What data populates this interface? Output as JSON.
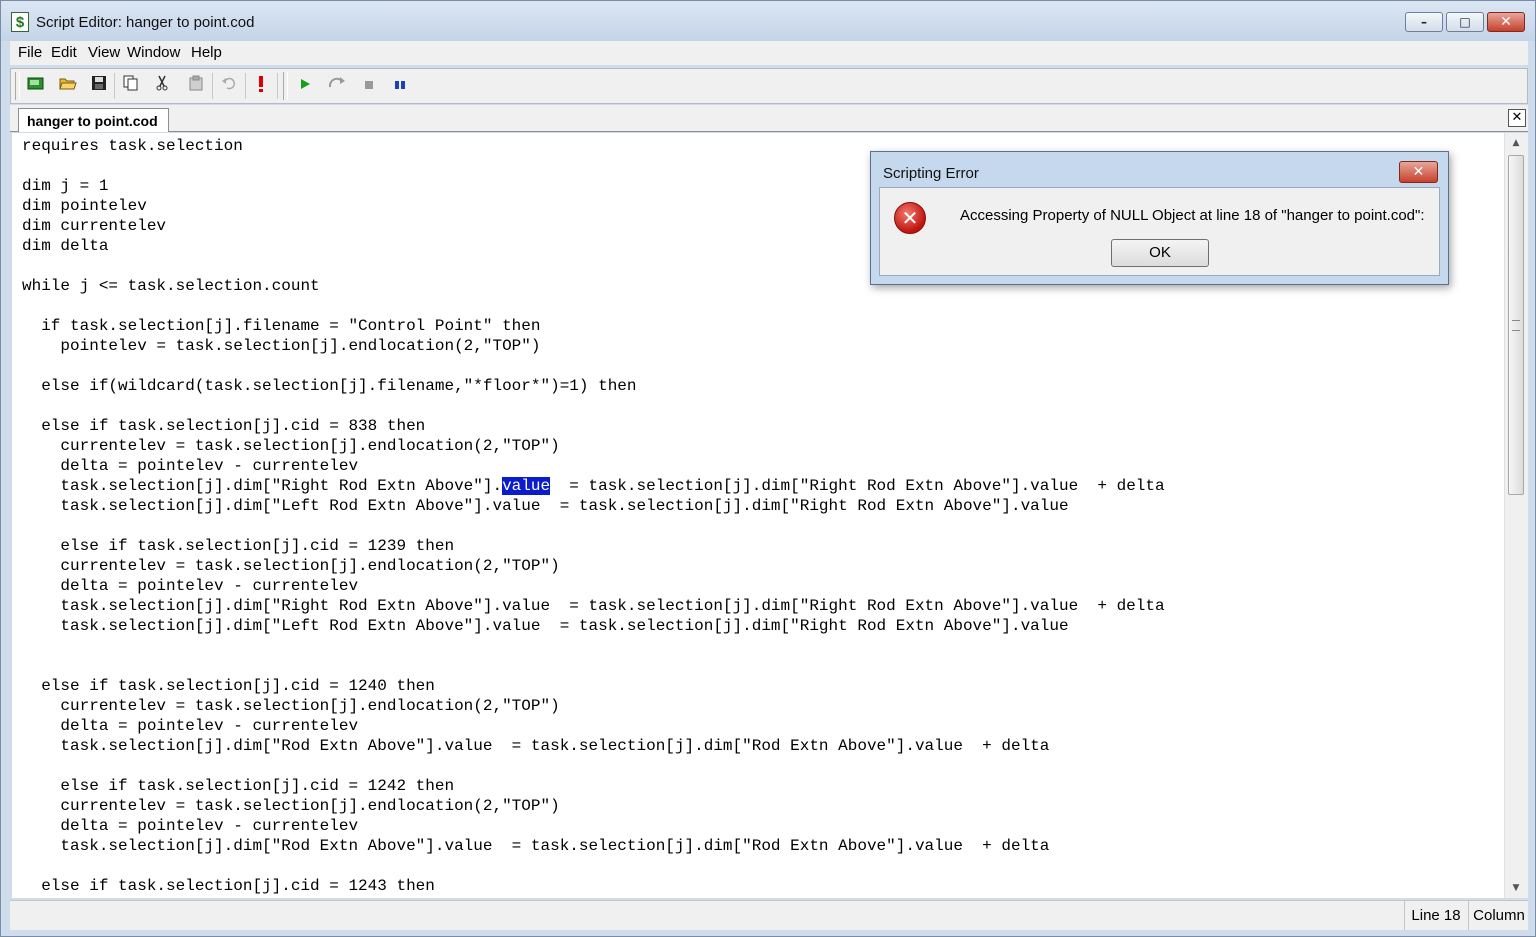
{
  "window": {
    "title": "Script Editor: hanger to point.cod",
    "controls": {
      "minimize": "–",
      "maximize": "□",
      "close": "✕"
    }
  },
  "menu": [
    "File",
    "Edit",
    "View",
    "Window",
    "Help"
  ],
  "toolbar": {
    "icons": [
      "new-script-icon",
      "open-folder-icon",
      "save-icon",
      "copy-icon",
      "cut-icon",
      "paste-icon",
      "undo-icon",
      "error-mark-icon",
      "run-icon",
      "step-icon",
      "stop-icon",
      "pause-icon"
    ]
  },
  "tab": {
    "label": "hanger to point.cod",
    "close": "✕"
  },
  "code": {
    "before": "requires task.selection\n\ndim j = 1\ndim pointelev\ndim currentelev\ndim delta\n\nwhile j <= task.selection.count\n\n  if task.selection[j].filename = \"Control Point\" then\n    pointelev = task.selection[j].endlocation(2,\"TOP\")\n\n  else if(wildcard(task.selection[j].filename,\"*floor*\")=1) then\n\n  else if task.selection[j].cid = 838 then\n    currentelev = task.selection[j].endlocation(2,\"TOP\")\n    delta = pointelev - currentelev\n    task.selection[j].dim[\"Right Rod Extn Above\"].",
    "selected": "value",
    "after": "  = task.selection[j].dim[\"Right Rod Extn Above\"].value  + delta\n    task.selection[j].dim[\"Left Rod Extn Above\"].value  = task.selection[j].dim[\"Right Rod Extn Above\"].value\n\n    else if task.selection[j].cid = 1239 then\n    currentelev = task.selection[j].endlocation(2,\"TOP\")\n    delta = pointelev - currentelev\n    task.selection[j].dim[\"Right Rod Extn Above\"].value  = task.selection[j].dim[\"Right Rod Extn Above\"].value  + delta\n    task.selection[j].dim[\"Left Rod Extn Above\"].value  = task.selection[j].dim[\"Right Rod Extn Above\"].value\n\n\n  else if task.selection[j].cid = 1240 then\n    currentelev = task.selection[j].endlocation(2,\"TOP\")\n    delta = pointelev - currentelev\n    task.selection[j].dim[\"Rod Extn Above\"].value  = task.selection[j].dim[\"Rod Extn Above\"].value  + delta\n\n    else if task.selection[j].cid = 1242 then\n    currentelev = task.selection[j].endlocation(2,\"TOP\")\n    delta = pointelev - currentelev\n    task.selection[j].dim[\"Rod Extn Above\"].value  = task.selection[j].dim[\"Rod Extn Above\"].value  + delta\n\n  else if task.selection[j].cid = 1243 then"
  },
  "status": {
    "line": "Line 18",
    "column": "Column"
  },
  "dialog": {
    "title": "Scripting Error",
    "close": "✕",
    "icon": "error-icon",
    "message": "Accessing Property of NULL Object at line 18 of \"hanger to point.cod\":",
    "ok_label": "OK"
  },
  "colors": {
    "selection": "#0a1ccc",
    "close_button": "#c7402c",
    "run_green": "#1a9e1a",
    "pause_blue": "#1a3fbf"
  }
}
